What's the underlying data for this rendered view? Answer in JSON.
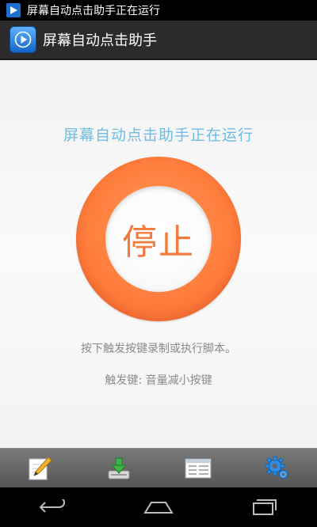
{
  "status_bar": {
    "notification_icon": "play-icon",
    "notification_text": "屏幕自动点击助手正在运行"
  },
  "action_bar": {
    "app_icon": "play-icon",
    "title": "屏幕自动点击助手"
  },
  "main": {
    "status_text": "屏幕自动点击助手正在运行",
    "stop_button_label": "停止",
    "hint": "按下触发按键录制或执行脚本。",
    "trigger_key": "触发键: 音量减小按键"
  },
  "toolbar": {
    "buttons": [
      {
        "icon": "pencil-icon"
      },
      {
        "icon": "download-icon"
      },
      {
        "icon": "window-list-icon"
      },
      {
        "icon": "gear-icon"
      }
    ]
  },
  "nav_bar": {
    "buttons": [
      {
        "icon": "back-icon"
      },
      {
        "icon": "home-icon"
      },
      {
        "icon": "recent-apps-icon"
      }
    ]
  },
  "colors": {
    "accent_text": "#6fbde6",
    "stop_ring": "#ff7e3d",
    "stop_label": "#f27a3c",
    "hint_text": "#8a8a8a",
    "action_bar": "#2b2b2b",
    "toolbar": "#666666"
  }
}
